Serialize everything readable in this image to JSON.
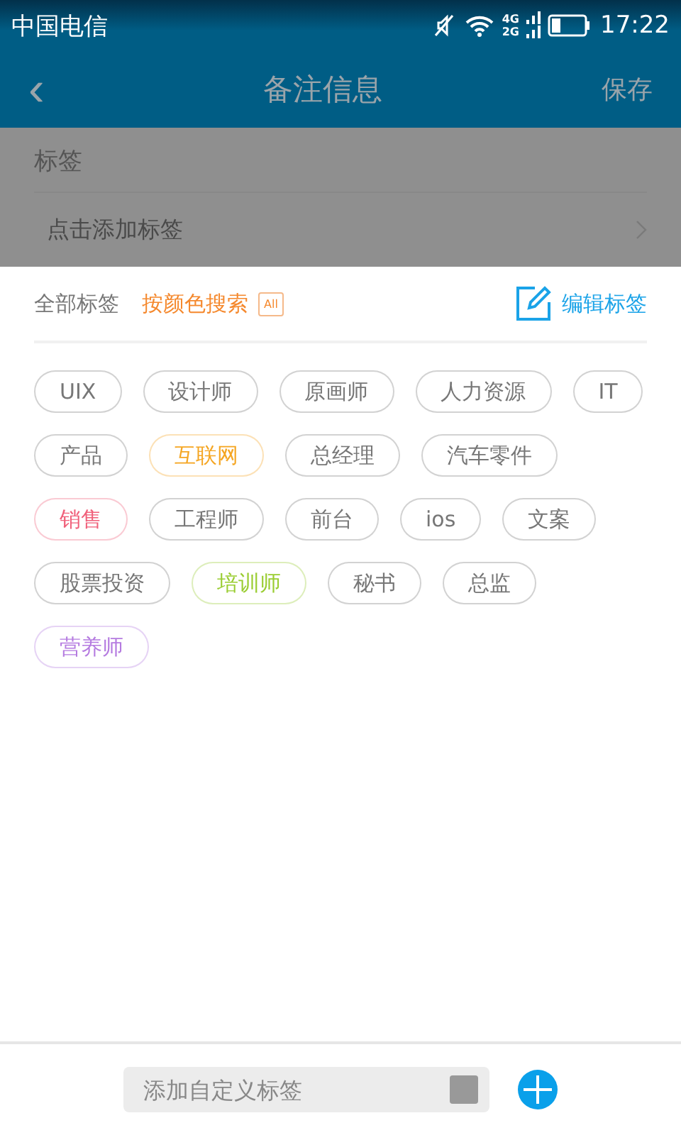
{
  "status_bar": {
    "carrier": "中国电信",
    "net_top": "4G",
    "net_bottom": "2G",
    "time": "17:22"
  },
  "header": {
    "back": "‹",
    "title": "备注信息",
    "save": "保存"
  },
  "tag_section": {
    "label": "标签",
    "placeholder": "点击添加标签"
  },
  "panel": {
    "all_tags": "全部标签",
    "color_search": "按颜色搜索",
    "all_badge": "All",
    "edit": "编辑标签"
  },
  "tags": [
    {
      "label": "UIX",
      "color": "#777777"
    },
    {
      "label": "设计师",
      "color": "#777777"
    },
    {
      "label": "原画师",
      "color": "#777777"
    },
    {
      "label": "人力资源",
      "color": "#777777"
    },
    {
      "label": "IT",
      "color": "#777777"
    },
    {
      "label": "产品",
      "color": "#777777"
    },
    {
      "label": "互联网",
      "color": "#f5a623"
    },
    {
      "label": "总经理",
      "color": "#777777"
    },
    {
      "label": "汽车零件",
      "color": "#777777"
    },
    {
      "label": "销售",
      "color": "#f0607a"
    },
    {
      "label": "工程师",
      "color": "#777777"
    },
    {
      "label": "前台",
      "color": "#777777"
    },
    {
      "label": "ios",
      "color": "#777777"
    },
    {
      "label": "文案",
      "color": "#777777"
    },
    {
      "label": "股票投资",
      "color": "#777777"
    },
    {
      "label": "培训师",
      "color": "#9acd32"
    },
    {
      "label": "秘书",
      "color": "#777777"
    },
    {
      "label": "总监",
      "color": "#777777"
    },
    {
      "label": "营养师",
      "color": "#b57be0"
    }
  ],
  "add_bar": {
    "placeholder": "添加自定义标签"
  }
}
